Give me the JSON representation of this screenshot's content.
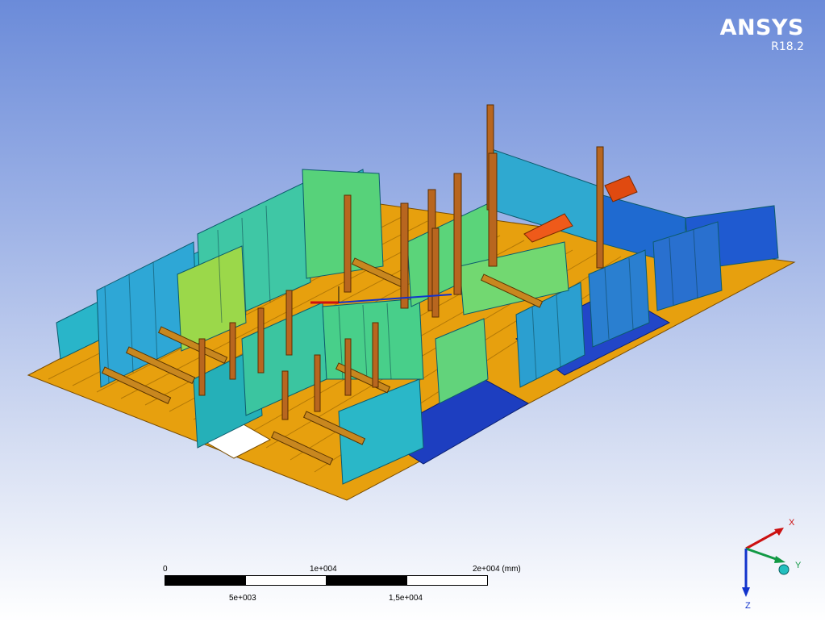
{
  "brand": {
    "name": "ANSYS",
    "version": "R18.2"
  },
  "scale_bar": {
    "top_labels": [
      "0",
      "1e+004",
      "2e+004 (mm)"
    ],
    "bottom_labels": [
      "5e+003",
      "1,5e+004"
    ]
  },
  "triad": {
    "x_label": "X",
    "y_label": "Y",
    "z_label": "Z"
  },
  "colors": {
    "background_top": "#6b8bd9",
    "background_bottom": "#ffffff",
    "orange_deck": "#e8a10f",
    "blue_frame": "#1e3fc2",
    "teal_frame": "#1fb6c9",
    "green_frame": "#5fd06a",
    "pillar_brown": "#b5651d",
    "axis_x": "#cc1111",
    "axis_y": "#119944",
    "axis_z": "#1133cc"
  }
}
